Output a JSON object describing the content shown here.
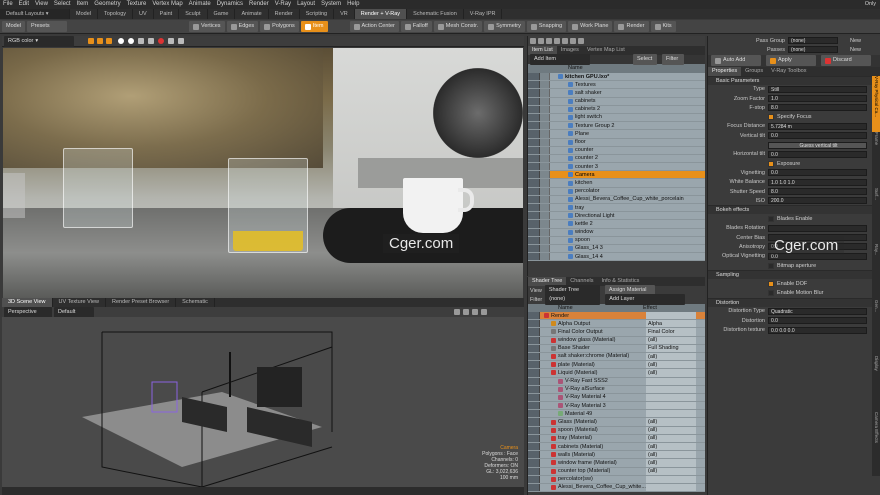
{
  "menu": [
    "File",
    "Edit",
    "View",
    "Select",
    "Item",
    "Geometry",
    "Texture",
    "Vertex Map",
    "Animate",
    "Dynamics",
    "Render",
    "V-Ray",
    "Layout",
    "System",
    "Help"
  ],
  "menu_right": "Only",
  "layout_name": "Default Layouts",
  "layout_tabs": [
    "Model",
    "Topology",
    "UV",
    "Paint",
    "Sculpt",
    "Game",
    "Animate",
    "Render",
    "Scripting",
    "VR",
    "Render + V-Ray",
    "Schematic Fusion",
    "V-Ray IPR"
  ],
  "layout_active": 10,
  "toolbar": {
    "left": [
      "Model",
      "Presets"
    ],
    "modes": [
      "Vertices",
      "Edges",
      "Polygons",
      "Item"
    ],
    "right": [
      "Action Center",
      "Falloff",
      "Mesh Constr.",
      "Symmetry",
      "Snapping",
      "Work Plane",
      "Render",
      "Kits"
    ]
  },
  "viewport": {
    "mode": "RGB color"
  },
  "watermark": "Cger.com",
  "vp2": {
    "tabs": [
      "3D Scene View",
      "UV Texture View",
      "Render Preset Browser",
      "Schematic"
    ],
    "view": "Perspective",
    "style": "Default",
    "info": [
      "Camera",
      "Polygons : Face",
      "Channels: 0",
      "Deformers: ON",
      "GL: 3,022,636",
      "100 mm"
    ]
  },
  "itemlist": {
    "tabs": [
      "Item List",
      "Images",
      "Vertex Map List"
    ],
    "add_item": "Add Item",
    "select": "Select",
    "filter": "Filter",
    "col_name": "Name",
    "items": [
      {
        "name": "kitchen GPU.lxo*",
        "indent": 0,
        "bold": true
      },
      {
        "name": "Textures",
        "indent": 1
      },
      {
        "name": "salt shaker",
        "indent": 1
      },
      {
        "name": "cabinets",
        "indent": 1
      },
      {
        "name": "cabinets 2",
        "indent": 1
      },
      {
        "name": "light switch",
        "indent": 1
      },
      {
        "name": "Texture Group 2",
        "indent": 1
      },
      {
        "name": "Plane",
        "indent": 1
      },
      {
        "name": "floor",
        "indent": 1
      },
      {
        "name": "counter",
        "indent": 1
      },
      {
        "name": "counter 2",
        "indent": 1
      },
      {
        "name": "counter 3",
        "indent": 1
      },
      {
        "name": "Camera",
        "indent": 1,
        "selected": true
      },
      {
        "name": "kitchen",
        "indent": 1
      },
      {
        "name": "percolator",
        "indent": 1
      },
      {
        "name": "Alessi_Bevera_Coffee_Cup_white_porcelain",
        "indent": 1
      },
      {
        "name": "tray",
        "indent": 1
      },
      {
        "name": "Directional Light",
        "indent": 1
      },
      {
        "name": "kettle 2",
        "indent": 1
      },
      {
        "name": "window",
        "indent": 1
      },
      {
        "name": "spoon",
        "indent": 1
      },
      {
        "name": "Glass_14 3",
        "indent": 1
      },
      {
        "name": "Glass_14 4",
        "indent": 1
      }
    ]
  },
  "shadertree": {
    "tabs": [
      "Shader Tree",
      "Channels",
      "Info & Statistics"
    ],
    "view": "View",
    "view_val": "Shader Tree",
    "assign": "Assign Material",
    "filter": "Filter",
    "filter_val": "(none)",
    "add_layer": "Add Layer",
    "cols": [
      "Name",
      "Effect"
    ],
    "items": [
      {
        "name": "Render",
        "effect": "",
        "indent": 0,
        "hl": true
      },
      {
        "name": "Alpha Output",
        "effect": "Alpha",
        "indent": 1
      },
      {
        "name": "Final Color Output",
        "effect": "Final Color",
        "indent": 1
      },
      {
        "name": "window glass (Material)",
        "effect": "(all)",
        "indent": 1
      },
      {
        "name": "Base Shader",
        "effect": "Full Shading",
        "indent": 1
      },
      {
        "name": "salt shaker:chrome (Material)",
        "effect": "(all)",
        "indent": 1
      },
      {
        "name": "plate (Material)",
        "effect": "(all)",
        "indent": 1
      },
      {
        "name": "Liquid (Material)",
        "effect": "(all)",
        "indent": 1
      },
      {
        "name": "V-Ray Fast SSS2",
        "effect": "",
        "indent": 2
      },
      {
        "name": "V-Ray alSurface",
        "effect": "",
        "indent": 2
      },
      {
        "name": "V-Ray Material 4",
        "effect": "",
        "indent": 2
      },
      {
        "name": "V-Ray Material 3",
        "effect": "",
        "indent": 2
      },
      {
        "name": "Material 49",
        "effect": "",
        "indent": 2
      },
      {
        "name": "Glass (Material)",
        "effect": "(all)",
        "indent": 1
      },
      {
        "name": "spoon (Material)",
        "effect": "(all)",
        "indent": 1
      },
      {
        "name": "tray (Material)",
        "effect": "(all)",
        "indent": 1
      },
      {
        "name": "cabinets (Material)",
        "effect": "(all)",
        "indent": 1
      },
      {
        "name": "walls (Material)",
        "effect": "(all)",
        "indent": 1
      },
      {
        "name": "window frame (Material)",
        "effect": "(all)",
        "indent": 1
      },
      {
        "name": "counter top (Material)",
        "effect": "(all)",
        "indent": 1
      },
      {
        "name": "percolator(sw)",
        "effect": "",
        "indent": 1
      },
      {
        "name": "Alessi_Bevera_Coffee_Cup_white...",
        "effect": "",
        "indent": 1
      }
    ]
  },
  "passes": {
    "pass_group": "Pass Group",
    "pass_group_val": "(none)",
    "passes": "Passes",
    "passes_val": "(none)",
    "new": "New"
  },
  "autoadd": {
    "auto": "Auto Add",
    "apply": "Apply",
    "discard": "Discard"
  },
  "props": {
    "tabs": [
      "Properties",
      "Groups",
      "V-Ray Toolbox"
    ],
    "side_tabs": [
      "V-Ray Physical Ca...",
      "Frame",
      "Surf...",
      "Ray...",
      "Gen...",
      "Display",
      "Camera Effects"
    ],
    "basic": "Basic Parameters",
    "rows": [
      {
        "label": "Type",
        "value": "Still"
      },
      {
        "label": "Zoom Factor",
        "value": "1.0"
      },
      {
        "label": "F-stop",
        "value": "8.0"
      },
      {
        "label": "",
        "value": "Specify Focus",
        "check": true
      },
      {
        "label": "Focus Distance",
        "value": "5.7284 m"
      },
      {
        "label": "Vertical tilt",
        "value": "0.0"
      },
      {
        "label": "",
        "value": "Guess vertical tilt",
        "button": true
      },
      {
        "label": "Horizontal tilt",
        "value": "0.0"
      },
      {
        "label": "",
        "value": "Exposure",
        "check": true
      },
      {
        "label": "Vignetting",
        "value": "0.0"
      },
      {
        "label": "White Balance",
        "value": "1.0    1.0    1.0"
      },
      {
        "label": "Shutter Speed",
        "value": "8.0"
      },
      {
        "label": "ISO",
        "value": "200.0"
      }
    ],
    "bokeh": "Bokeh effects",
    "bokeh_rows": [
      {
        "label": "",
        "value": "Blades Enable",
        "check": false
      },
      {
        "label": "Blades Rotation",
        "value": ""
      },
      {
        "label": "Center Bias",
        "value": ""
      },
      {
        "label": "Anisotropy",
        "value": "0.0"
      },
      {
        "label": "Optical Vignetting",
        "value": "0.0"
      },
      {
        "label": "",
        "value": "Bitmap aperture",
        "check": false
      }
    ],
    "sampling": "Sampling",
    "sampling_rows": [
      {
        "label": "",
        "value": "Enable DOF",
        "check": true
      },
      {
        "label": "",
        "value": "Enable Motion Blur",
        "check": false
      }
    ],
    "distortion": "Distortion",
    "distortion_rows": [
      {
        "label": "Distortion Type",
        "value": "Quadratic"
      },
      {
        "label": "Distortion",
        "value": "0.0"
      },
      {
        "label": "Distortion texture",
        "value": "0.0    0.0    0.0"
      }
    ]
  }
}
